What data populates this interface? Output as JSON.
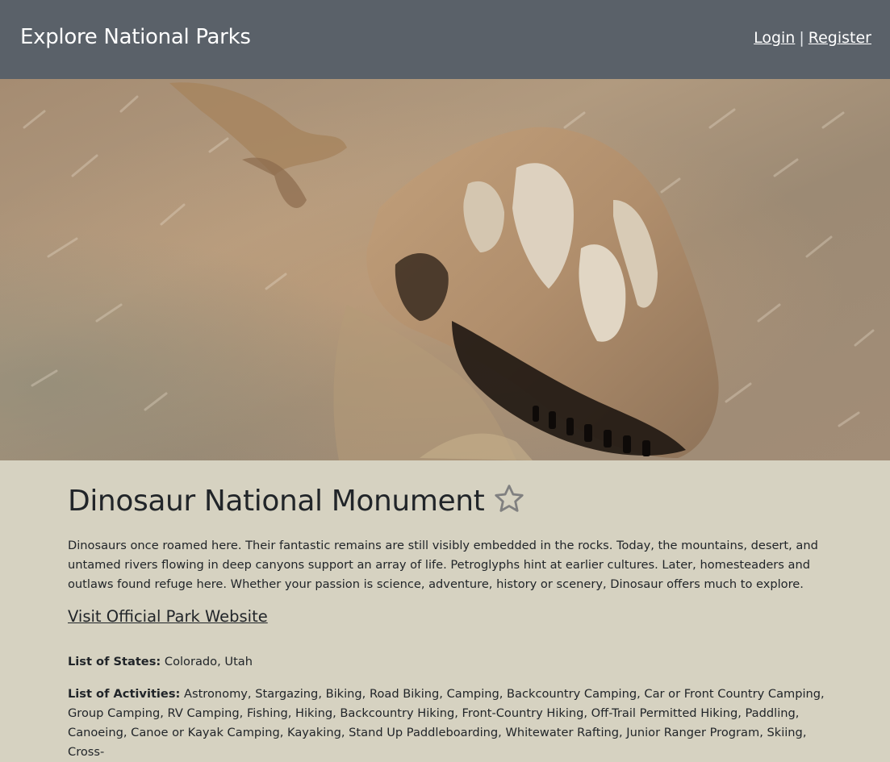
{
  "navbar": {
    "brand": "Explore National Parks",
    "login_label": "Login",
    "separator": "|",
    "register_label": "Register",
    "background_color": "#5a6169"
  },
  "hero": {
    "image_icon": "dinosaur-fossil-photo"
  },
  "park": {
    "name": "Dinosaur National Monument",
    "favorite_icon": "star-outline-icon",
    "description": "Dinosaurs once roamed here. Their fantastic remains are still visibly embedded in the rocks. Today, the mountains, desert, and untamed rivers flowing in deep canyons support an array of life. Petroglyphs hint at earlier cultures. Later, homesteaders and outlaws found refuge here. Whether your passion is science, adventure, history or scenery, Dinosaur offers much to explore.",
    "website_label": "Visit Official Park Website",
    "states_label": "List of States:",
    "states_value": "Colorado, Utah",
    "activities_label": "List of Activities:",
    "activities_value": "Astronomy, Stargazing, Biking, Road Biking, Camping, Backcountry Camping, Car or Front Country Camping, Group Camping, RV Camping, Fishing, Hiking, Backcountry Hiking, Front-Country Hiking, Off-Trail Permitted Hiking, Paddling, Canoeing, Canoe or Kayak Camping, Kayaking, Stand Up Paddleboarding, Whitewater Rafting, Junior Ranger Program, Skiing, Cross-"
  },
  "colors": {
    "page_background": "#d6d2c1",
    "text": "#212529"
  }
}
